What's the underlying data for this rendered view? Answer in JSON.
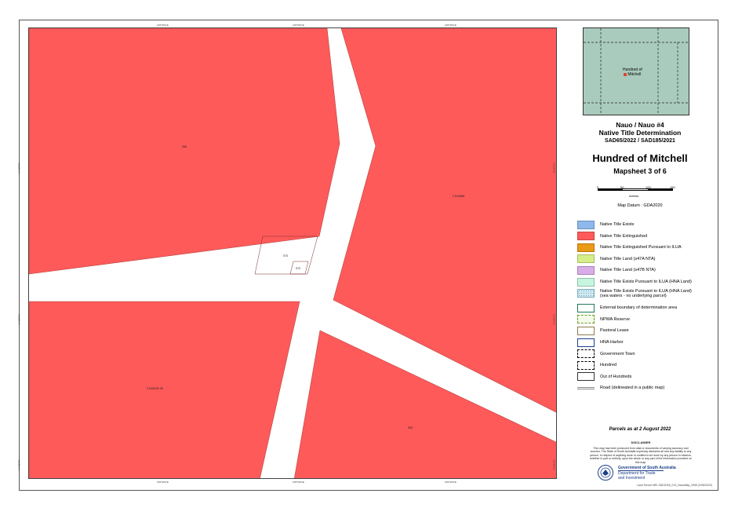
{
  "map": {
    "ticks": {
      "top": [
        "135°50'0\"E",
        "135°50'0\"E",
        "135°50'0\"E"
      ],
      "bottom": [
        "135°50'0\"E",
        "135°50'0\"E",
        "135°50'0\"E"
      ],
      "left": [
        "34°20'0\"S",
        "34°20'0\"S",
        "34°20'0\"S"
      ],
      "right": [
        "34°20'0\"S",
        "34°20'0\"S",
        "34°20'0\"S"
      ]
    },
    "parcels": {
      "top_left": "S56",
      "top_right": "F1159964",
      "small_a": "S70",
      "small_b": "S72",
      "bottom_left": "F1160235 S8",
      "bottom_right": "S53"
    },
    "colors": {
      "extinguished": "#ff5a5a",
      "road": "#ffffff"
    }
  },
  "inset": {
    "label_line1": "Hundred of",
    "label_line2": "Mitchell"
  },
  "title": {
    "line1": "Nauo / Nauo #4",
    "line2": "Native Title Determination",
    "line3": "SAD65/2022 / SAD185/2021",
    "hundred": "Hundred of Mitchell",
    "mapsheet": "Mapsheet 3 of 6"
  },
  "scale": {
    "ticks": [
      "0",
      "50",
      "100",
      "150"
    ],
    "unit": "metres"
  },
  "datum": "Map Datum : GDA2020",
  "legend": [
    {
      "label": "Native Title Exists",
      "fill": "#8fb8ec",
      "border": "#6f8fb8",
      "style": "solid"
    },
    {
      "label": "Native Title Extinguished",
      "fill": "#ff5a5a",
      "border": "#c84444",
      "style": "solid"
    },
    {
      "label": "Native Title Extinguished Pursuant to ILUA",
      "fill": "#e99a16",
      "border": "#b87510",
      "style": "solid"
    },
    {
      "label": "Native Title Land (s47A NTA)",
      "fill": "#d6ee88",
      "border": "#a8bd66",
      "style": "solid"
    },
    {
      "label": "Native Title Land (s47B NTA)",
      "fill": "#d9aee8",
      "border": "#a883b6",
      "style": "solid"
    },
    {
      "label": "Native Title Exists Pursuant to ILUA (HNA Land)",
      "fill": "#c6f5e0",
      "border": "#8fc2ab",
      "style": "solid"
    },
    {
      "label": "Native Title Exists Pursuant to ILUA (HNA Land)",
      "label2": "(sea waters - no underlying parcel)",
      "fill": "#cfe9f2",
      "border": "#7aa9b8",
      "style": "pattern"
    },
    {
      "label": "External boundary of determination area",
      "fill": "#ffffff",
      "border": "#1f7a55",
      "style": "thick"
    },
    {
      "label": "NPWA Reserve",
      "fill": "#f4fbe8",
      "border": "#6b9a2e",
      "style": "dashed"
    },
    {
      "label": "Pastoral Lease",
      "fill": "#ffffff",
      "border": "#8d7a4a",
      "style": "solid"
    },
    {
      "label": "HNA Harbor",
      "fill": "#ffffff",
      "border": "#1b3f8b",
      "style": "solid"
    },
    {
      "label": "Government Town",
      "fill": "#ffffff",
      "border": "#000000",
      "style": "dashed"
    },
    {
      "label": "Hundred",
      "fill": "#ffffff",
      "border": "#000000",
      "style": "longdash"
    },
    {
      "label": "Out of Hundreds",
      "fill": "#ffffff",
      "border": "#333333",
      "style": "solid"
    },
    {
      "label": "Road (delineated in a public map)",
      "fill": "none",
      "border": "#888888",
      "style": "line"
    }
  ],
  "parcels_date": "Parcels as at 2 August 2022",
  "disclaimer": {
    "heading": "DISCLAIMER",
    "text": "This map has been produced from data or documents of varying accuracy and sources. The State of South Australia expressly disclaims all and any liability to any person, in respect of anything done or omitted to be done by any person in reliance, whether in part or entirely, upon the whole or any part of the information provided on this map."
  },
  "government": {
    "line1": "Government of South Australia",
    "line2": "Department for Trade",
    "line3": "and Investment"
  },
  "footer": "Land Tenure MB: SAD2018_013_NauoMap_0305 (2/08/2022)"
}
